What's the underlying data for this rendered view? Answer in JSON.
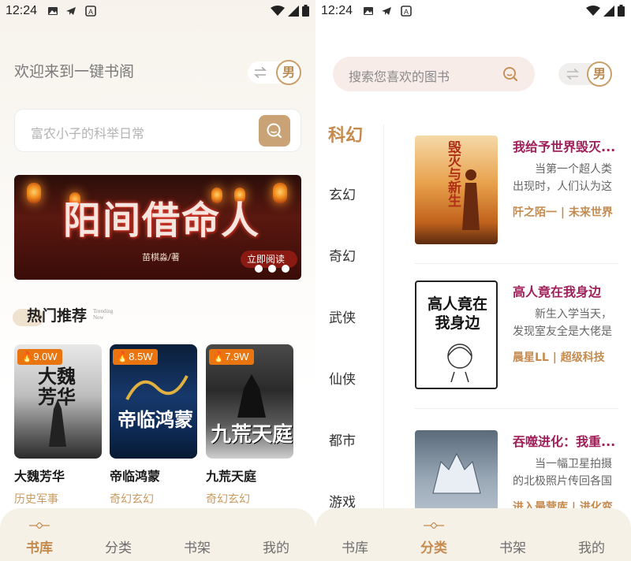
{
  "status_bar": {
    "time": "12:24"
  },
  "left": {
    "welcome": "欢迎来到一键书阁",
    "gender": "男",
    "search_placeholder": "富农小子的科举日常",
    "banner": {
      "title": "阳间借命人",
      "author": "苗棋淼/著",
      "read_label": "立即阅读"
    },
    "section": {
      "title": "热门推荐",
      "subtitle_line1": "Trending",
      "subtitle_line2": "Now"
    },
    "books": [
      {
        "heat": "9.0W",
        "name": "大魏芳华",
        "tag": "历史军事",
        "cover_text": "大魏芳华"
      },
      {
        "heat": "8.5W",
        "name": "帝临鸿蒙",
        "tag": "奇幻玄幻",
        "cover_text": "帝临鸿蒙"
      },
      {
        "heat": "7.9W",
        "name": "九荒天庭",
        "tag": "奇幻玄幻",
        "cover_text": "九荒天庭"
      }
    ],
    "nav": [
      "书库",
      "分类",
      "书架",
      "我的"
    ],
    "nav_active": 0
  },
  "right": {
    "search_placeholder": "搜索您喜欢的图书",
    "gender": "男",
    "categories": [
      "科幻",
      "玄幻",
      "奇幻",
      "武侠",
      "仙侠",
      "都市",
      "游戏"
    ],
    "active_category": 0,
    "books": [
      {
        "title": "我给予世界毁灭...",
        "desc": "当第一个超人类出现时，人们认为这是...",
        "author": "阡之陌一",
        "genre": "未来世界",
        "cover_text": "毁灭与新生"
      },
      {
        "title": "高人竟在我身边",
        "desc": "新生入学当天，发现室友全是大佬是一...",
        "author": "晨星LL",
        "genre": "超级科技",
        "cover_text": "高人竟在我身边"
      },
      {
        "title": "吞噬进化：我重...",
        "desc": "当一幅卫星拍摄的北极照片传回各国时...",
        "author": "进入最营库",
        "genre": "进化变",
        "cover_text": ""
      }
    ],
    "nav": [
      "书库",
      "分类",
      "书架",
      "我的"
    ],
    "nav_active": 1
  },
  "colors": {
    "accent": "#c48a4e",
    "title_red": "#a0205a",
    "badge_orange": "#e8750f"
  }
}
